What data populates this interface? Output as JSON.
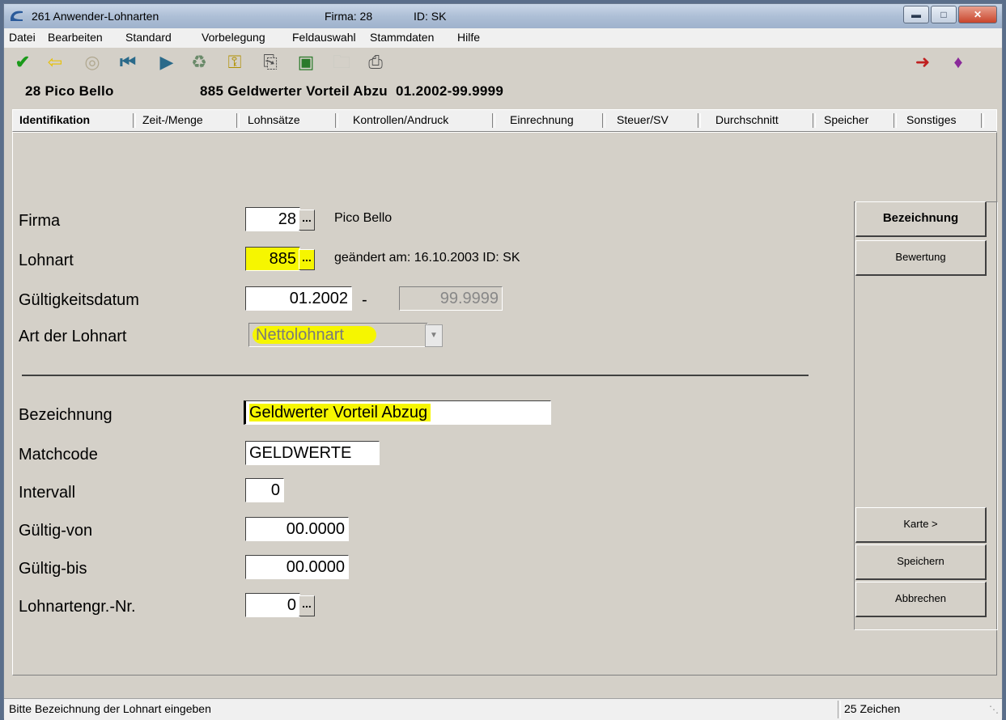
{
  "titlebar": {
    "title": "261 Anwender-Lohnarten",
    "firma": "Firma: 28",
    "id": "ID: SK"
  },
  "menu": [
    "Datei",
    "Bearbeiten",
    "Standard",
    "Vorbelegung",
    "Feldauswahl",
    "Stammdaten",
    "Hilfe"
  ],
  "header": {
    "company": "28 Pico Bello",
    "lohnart": "885 Geldwerter Vorteil Abzu  01.2002-99.9999"
  },
  "tabs": [
    "Identifikation",
    "Zeit-/Menge",
    "Lohnsätze",
    "Kontrollen/Andruck",
    "Einrechnung",
    "Steuer/SV",
    "Durchschnitt",
    "Speicher",
    "Sonstiges"
  ],
  "form": {
    "firma_label": "Firma",
    "firma_value": "28",
    "firma_name": "Pico Bello",
    "lohnart_label": "Lohnart",
    "lohnart_value": "885",
    "lohnart_info": "geändert am: 16.10.2003 ID: SK",
    "gueltig_label": "Gültigkeitsdatum",
    "gueltig_from": "01.2002",
    "gueltig_dash": "-",
    "gueltig_to": "99.9999",
    "art_label": "Art der Lohnart",
    "art_value": "Nettolohnart",
    "bezeichnung_label": "Bezeichnung",
    "bezeichnung_value": "Geldwerter Vorteil Abzug",
    "matchcode_label": "Matchcode",
    "matchcode_value": "GELDWERTE",
    "intervall_label": "Intervall",
    "intervall_value": "0",
    "von_label": "Gültig-von",
    "von_value": "00.0000",
    "bis_label": "Gültig-bis",
    "bis_value": "00.0000",
    "gruppe_label": "Lohnartengr.-Nr.",
    "gruppe_value": "0",
    "dots": "..."
  },
  "buttons": {
    "bezeichnung": "Bezeichnung",
    "bewertung": "Bewertung",
    "karte": "Karte >",
    "speichern": "Speichern",
    "abbrechen": "Abbrechen"
  },
  "status": {
    "message": "Bitte Bezeichnung der Lohnart eingeben",
    "chars": "25 Zeichen"
  },
  "colors": {
    "highlight": "#f6f600",
    "accept": "#1a9a1a",
    "nav": "#2a6a8a"
  }
}
